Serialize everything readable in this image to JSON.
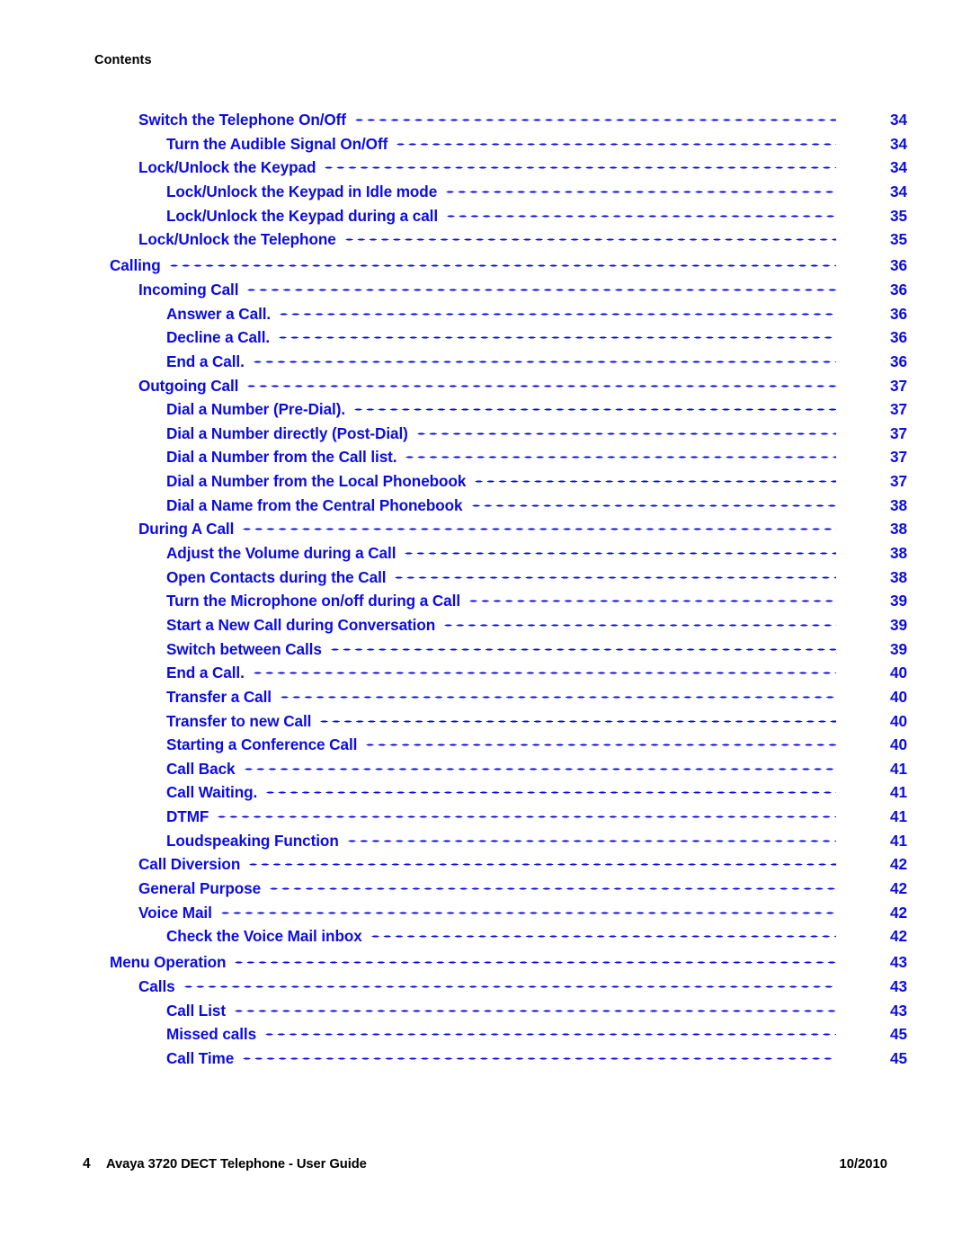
{
  "document": {
    "running_header": "Contents",
    "accent_color": "#0c0ce0",
    "text_color": "#000000"
  },
  "toc": {
    "entries": [
      {
        "title": "Switch the Telephone On/Off",
        "page": "34",
        "level": 1,
        "gap_before": false
      },
      {
        "title": "Turn the Audible Signal On/Off",
        "page": "34",
        "level": 2,
        "gap_before": false
      },
      {
        "title": "Lock/Unlock the Keypad",
        "page": "34",
        "level": 1,
        "gap_before": false
      },
      {
        "title": "Lock/Unlock the Keypad in Idle mode",
        "page": "34",
        "level": 2,
        "gap_before": false
      },
      {
        "title": "Lock/Unlock the Keypad during a call",
        "page": "35",
        "level": 2,
        "gap_before": false
      },
      {
        "title": "Lock/Unlock the Telephone",
        "page": "35",
        "level": 1,
        "gap_before": false
      },
      {
        "title": "Calling",
        "page": "36",
        "level": 0,
        "gap_before": true
      },
      {
        "title": "Incoming Call",
        "page": "36",
        "level": 1,
        "gap_before": false
      },
      {
        "title": "Answer a Call.",
        "page": "36",
        "level": 2,
        "gap_before": false
      },
      {
        "title": "Decline a Call.",
        "page": "36",
        "level": 2,
        "gap_before": false
      },
      {
        "title": "End a Call.",
        "page": "36",
        "level": 2,
        "gap_before": false
      },
      {
        "title": "Outgoing Call",
        "page": "37",
        "level": 1,
        "gap_before": false
      },
      {
        "title": "Dial a Number (Pre-Dial).",
        "page": "37",
        "level": 2,
        "gap_before": false
      },
      {
        "title": "Dial a Number directly (Post-Dial)",
        "page": "37",
        "level": 2,
        "gap_before": false
      },
      {
        "title": "Dial a Number from the Call list.",
        "page": "37",
        "level": 2,
        "gap_before": false
      },
      {
        "title": "Dial a Number from the Local Phonebook",
        "page": "37",
        "level": 2,
        "gap_before": false
      },
      {
        "title": "Dial a Name from the Central Phonebook",
        "page": "38",
        "level": 2,
        "gap_before": false
      },
      {
        "title": "During A Call",
        "page": "38",
        "level": 1,
        "gap_before": false
      },
      {
        "title": "Adjust the Volume during a Call",
        "page": "38",
        "level": 2,
        "gap_before": false
      },
      {
        "title": "Open Contacts during the Call",
        "page": "38",
        "level": 2,
        "gap_before": false
      },
      {
        "title": "Turn the Microphone on/off during a Call",
        "page": "39",
        "level": 2,
        "gap_before": false
      },
      {
        "title": "Start a New Call during Conversation",
        "page": "39",
        "level": 2,
        "gap_before": false
      },
      {
        "title": "Switch between Calls",
        "page": "39",
        "level": 2,
        "gap_before": false
      },
      {
        "title": "End a Call.",
        "page": "40",
        "level": 2,
        "gap_before": false
      },
      {
        "title": "Transfer a Call",
        "page": "40",
        "level": 2,
        "gap_before": false
      },
      {
        "title": "Transfer to new Call",
        "page": "40",
        "level": 2,
        "gap_before": false
      },
      {
        "title": "Starting a Conference Call",
        "page": "40",
        "level": 2,
        "gap_before": false
      },
      {
        "title": "Call Back",
        "page": "41",
        "level": 2,
        "gap_before": false
      },
      {
        "title": "Call Waiting.",
        "page": "41",
        "level": 2,
        "gap_before": false
      },
      {
        "title": "DTMF",
        "page": "41",
        "level": 2,
        "gap_before": false
      },
      {
        "title": "Loudspeaking Function",
        "page": "41",
        "level": 2,
        "gap_before": false
      },
      {
        "title": "Call Diversion",
        "page": "42",
        "level": 1,
        "gap_before": false
      },
      {
        "title": "General Purpose",
        "page": "42",
        "level": 1,
        "gap_before": false
      },
      {
        "title": "Voice Mail",
        "page": "42",
        "level": 1,
        "gap_before": false
      },
      {
        "title": "Check the Voice Mail inbox",
        "page": "42",
        "level": 2,
        "gap_before": false
      },
      {
        "title": "Menu Operation",
        "page": "43",
        "level": 0,
        "gap_before": true
      },
      {
        "title": "Calls",
        "page": "43",
        "level": 1,
        "gap_before": false
      },
      {
        "title": "Call List",
        "page": "43",
        "level": 2,
        "gap_before": false
      },
      {
        "title": "Missed calls",
        "page": "45",
        "level": 2,
        "gap_before": false
      },
      {
        "title": "Call Time",
        "page": "45",
        "level": 2,
        "gap_before": false
      }
    ]
  },
  "footer": {
    "page_number": "4",
    "title": "Avaya 3720 DECT Telephone - User Guide",
    "date": "10/2010"
  }
}
